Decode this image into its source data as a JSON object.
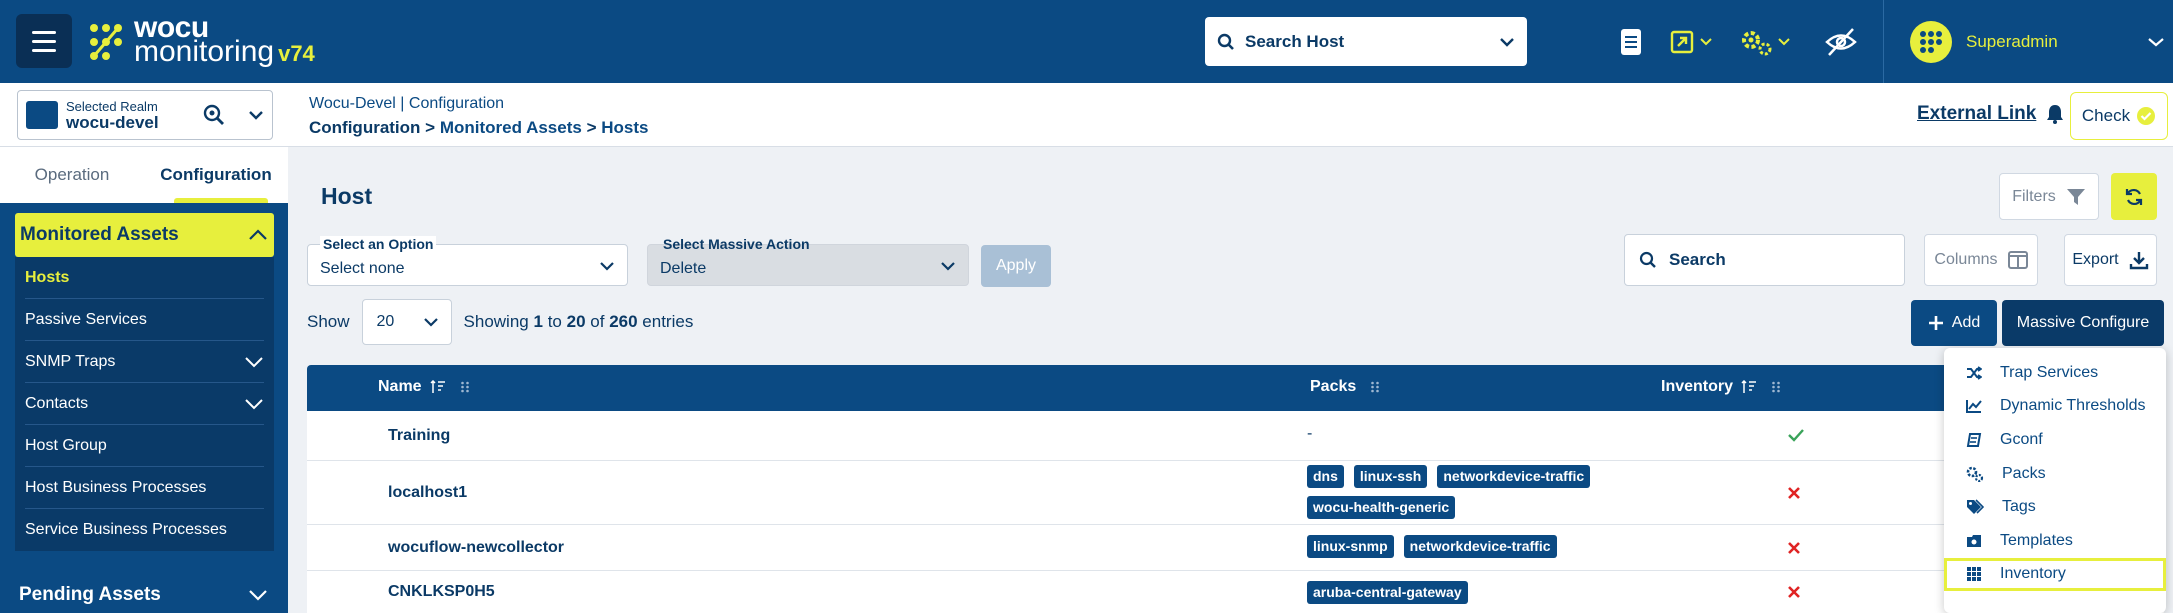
{
  "header": {
    "logo_line1": "wocu",
    "logo_line2": "monitoring",
    "version": "v74",
    "host_search_label": "Search Host",
    "user_name": "Superadmin",
    "colors": {
      "primary": "#0b4a83",
      "accent": "#e7ef3d",
      "dark": "#0a3a68"
    }
  },
  "realm": {
    "label": "Selected Realm",
    "value": "wocu-devel"
  },
  "breadcrumbs": {
    "line1_a": "Wocu-Devel",
    "line1_sep": "|",
    "line1_b": "Configuration",
    "line2_a": "Configuration",
    "line2_sep1": ">",
    "line2_b": "Monitored Assets",
    "line2_sep2": ">",
    "line2_c": "Hosts"
  },
  "actions": {
    "external_link": "External Link",
    "check": "Check"
  },
  "sidebar": {
    "tabs": [
      "Operation",
      "Configuration"
    ],
    "group_title": "Monitored Assets",
    "items": [
      {
        "label": "Hosts",
        "active": true,
        "expandable": false
      },
      {
        "label": "Passive Services",
        "active": false,
        "expandable": false
      },
      {
        "label": "SNMP Traps",
        "active": false,
        "expandable": true
      },
      {
        "label": "Contacts",
        "active": false,
        "expandable": true
      },
      {
        "label": "Host Group",
        "active": false,
        "expandable": false
      },
      {
        "label": "Host Business Processes",
        "active": false,
        "expandable": false
      },
      {
        "label": "Service Business Processes",
        "active": false,
        "expandable": false
      }
    ],
    "pending_title": "Pending Assets"
  },
  "main": {
    "title": "Host",
    "filters_label": "Filters",
    "option_select": {
      "label": "Select an Option",
      "value": "Select none"
    },
    "massive_action": {
      "label": "Select Massive Action",
      "value": "Delete"
    },
    "apply_label": "Apply",
    "search_placeholder": "Search",
    "columns_label": "Columns",
    "export_label": "Export",
    "show_label": "Show",
    "page_size": "20",
    "entries": {
      "prefix": "Showing",
      "from": "1",
      "to_word": "to",
      "to": "20",
      "of_word": "of",
      "total": "260",
      "suffix": "entries"
    },
    "add_label": "Add",
    "massive_configure_label": "Massive Configure"
  },
  "table": {
    "columns": {
      "name": "Name",
      "packs": "Packs",
      "inventory": "Inventory"
    },
    "rows": [
      {
        "name": "Training",
        "packs": [],
        "packs_text": "-",
        "inventory": true
      },
      {
        "name": "localhost1",
        "packs": [
          "dns",
          "linux-ssh",
          "networkdevice-traffic",
          "wocu-health-generic"
        ],
        "inventory": false
      },
      {
        "name": "wocuflow-newcollector",
        "packs": [
          "linux-snmp",
          "networkdevice-traffic"
        ],
        "inventory": false
      },
      {
        "name": "CNKLKSP0H5",
        "packs": [
          "aruba-central-gateway"
        ],
        "inventory": false
      }
    ]
  },
  "menu": {
    "items": [
      {
        "label": "Trap Services",
        "icon": "shuffle-icon"
      },
      {
        "label": "Dynamic Thresholds",
        "icon": "chart-line-icon"
      },
      {
        "label": "Gconf",
        "icon": "gconf-icon"
      },
      {
        "label": "Packs",
        "icon": "gears-icon"
      },
      {
        "label": "Tags",
        "icon": "tags-icon"
      },
      {
        "label": "Templates",
        "icon": "template-icon"
      },
      {
        "label": "Inventory",
        "icon": "grid-icon",
        "highlighted": true
      }
    ]
  }
}
